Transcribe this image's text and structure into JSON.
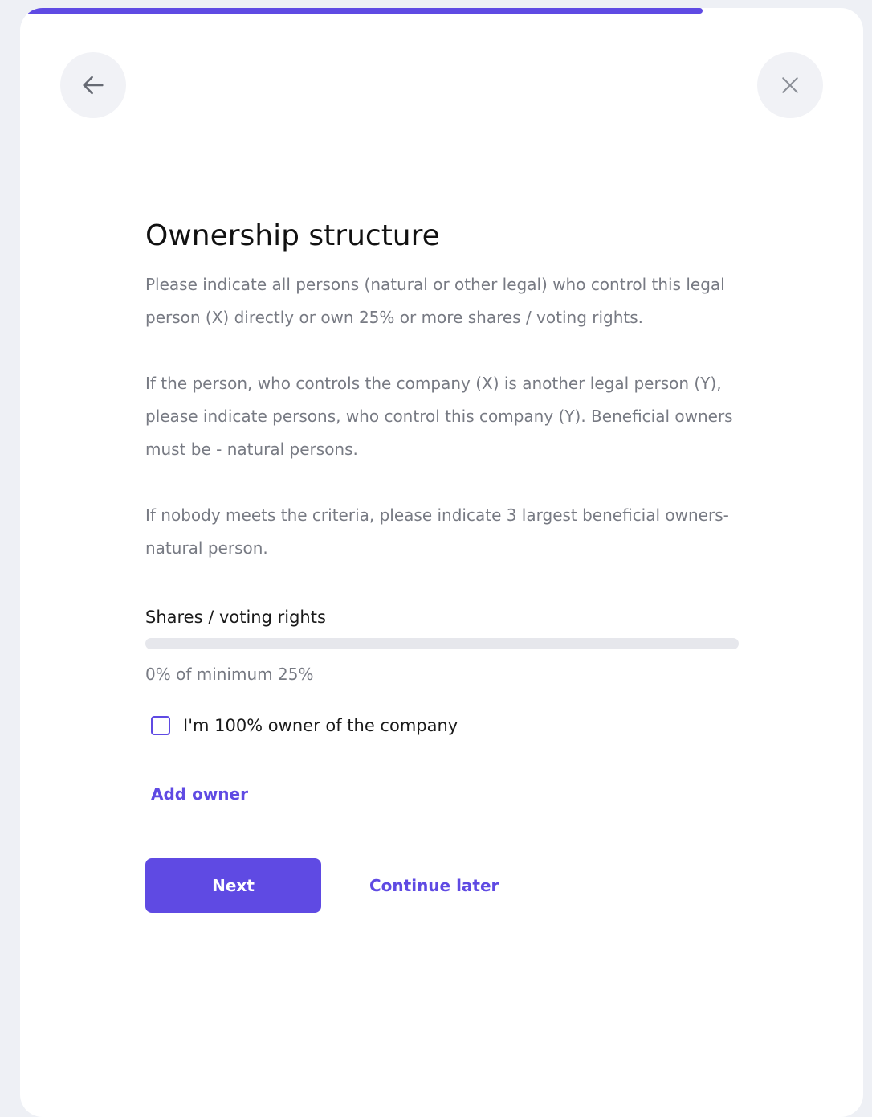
{
  "progress": {
    "step_fraction": 0.8
  },
  "header": {
    "back_icon": "arrow-left-icon",
    "close_icon": "close-icon"
  },
  "main": {
    "title": "Ownership structure",
    "paragraphs": [
      "Please indicate all persons (natural or other legal) who control this legal person (X) directly or own 25% or more shares / voting rights.",
      "If the person, who controls the company (X) is another legal person (Y), please indicate persons, who control this company (Y). Beneficial owners must be - natural persons.",
      "If nobody meets the criteria, please indicate 3 largest beneficial owners-natural person."
    ],
    "shares": {
      "label": "Shares / voting rights",
      "percent": 0,
      "status_text": "0% of minimum 25%"
    },
    "checkbox": {
      "label": "I'm 100% owner of the company",
      "checked": false
    },
    "add_owner_label": "Add owner",
    "next_label": "Next",
    "continue_later_label": "Continue later"
  },
  "colors": {
    "accent": "#5f4ae3",
    "muted_text": "#777a83",
    "track": "#e6e7ec",
    "page_bg": "#eef0f5"
  }
}
